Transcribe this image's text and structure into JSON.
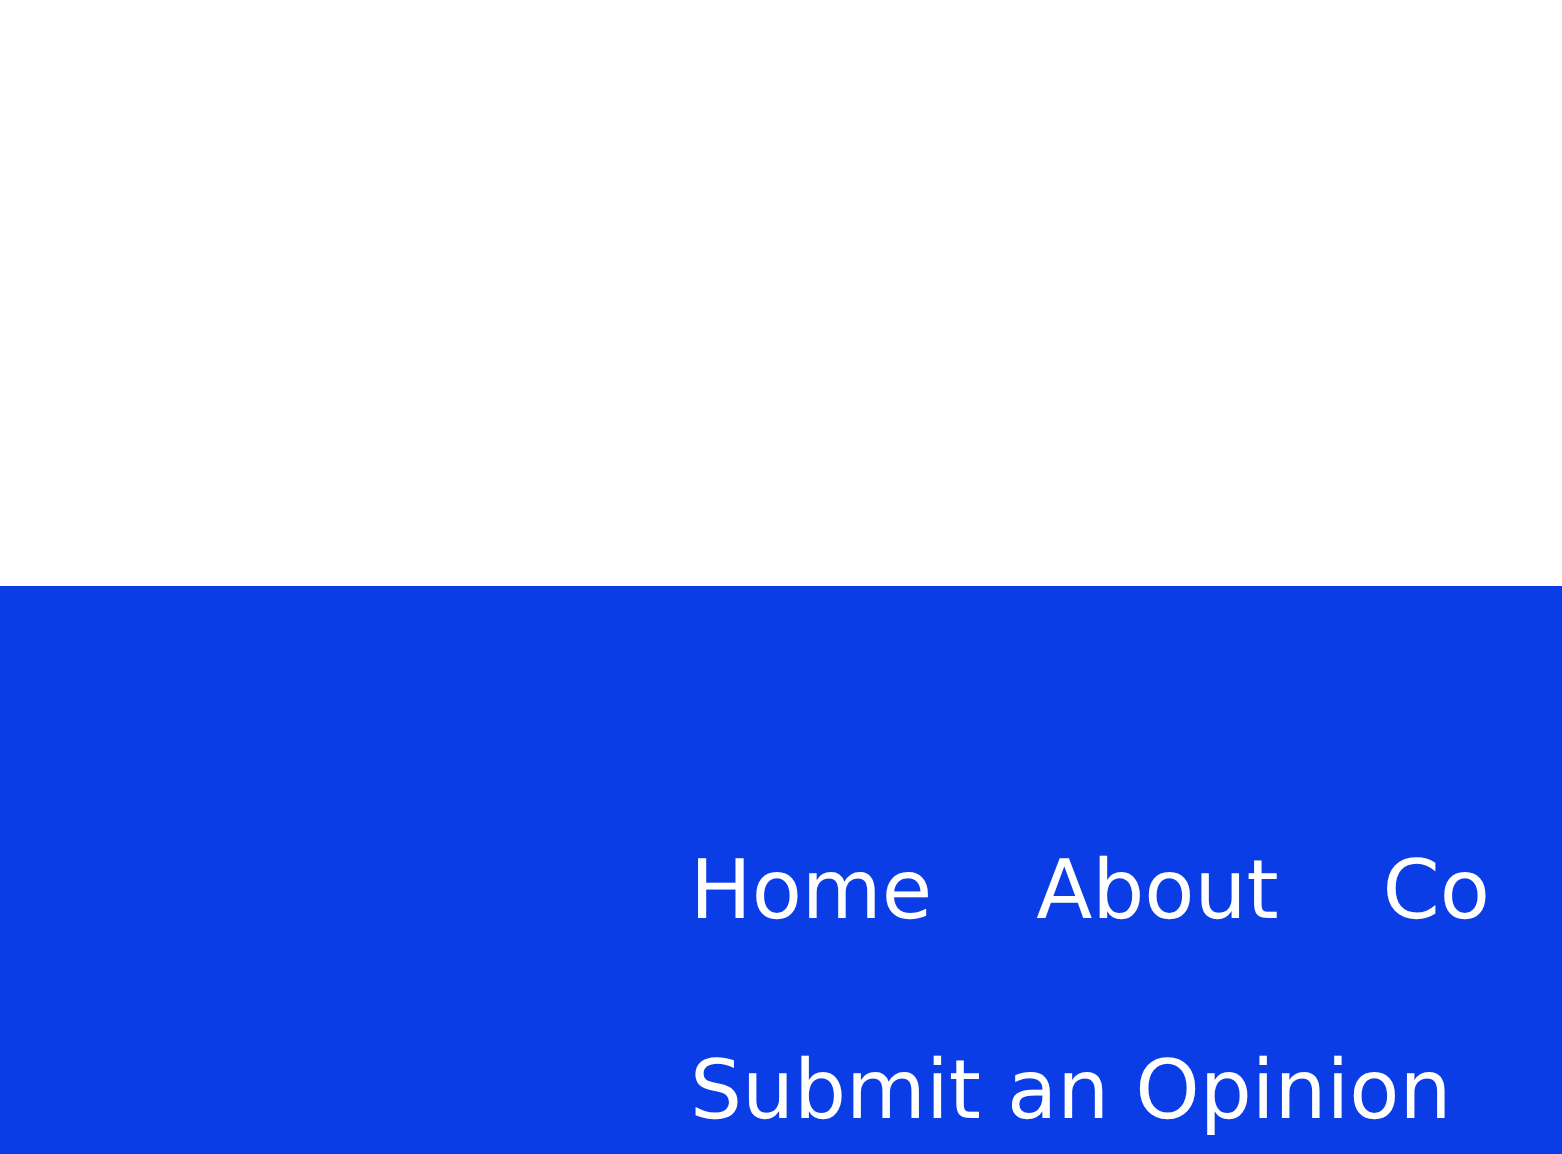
{
  "footer": {
    "links": [
      {
        "label": "Home"
      },
      {
        "label": "About"
      },
      {
        "label": "Co"
      }
    ],
    "secondary_links": [
      {
        "label": "Submit an Opinion"
      }
    ]
  }
}
